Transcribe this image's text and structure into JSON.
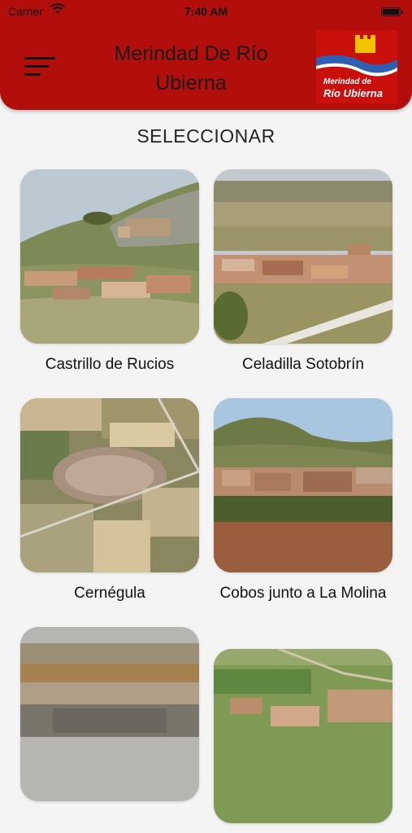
{
  "status_bar": {
    "carrier": "Carrier",
    "time": "7:40 AM"
  },
  "header": {
    "title": "Merindad De Río Ubierna",
    "logo": {
      "line1": "Merindad de",
      "line2": "Río Ubierna"
    },
    "menu_icon": "hamburger-menu-icon"
  },
  "section": {
    "title": "SELECCIONAR"
  },
  "villages": [
    {
      "name": "Castrillo de Rucios"
    },
    {
      "name": "Celadilla Sotobrín"
    },
    {
      "name": "Cernégula"
    },
    {
      "name": "Cobos junto a La Molina"
    },
    {
      "name": ""
    },
    {
      "name": ""
    }
  ],
  "colors": {
    "header_red": "#b20e0b",
    "logo_red": "#c9100c",
    "logo_yellow": "#f2c400",
    "logo_blue": "#2f5fb3",
    "background": "#f4f4f4"
  }
}
